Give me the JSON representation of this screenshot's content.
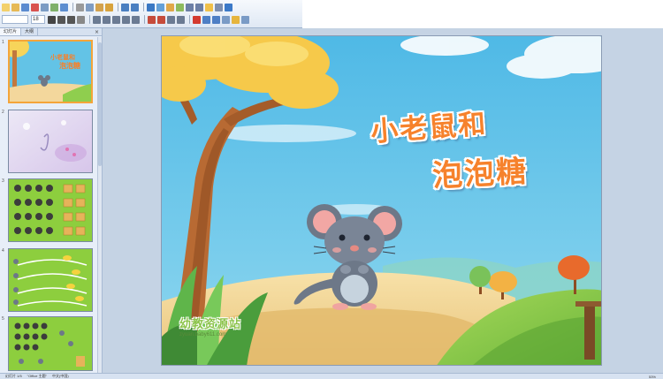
{
  "toolbar": {
    "font_size_value": "18"
  },
  "pane": {
    "tabs": [
      "幻灯片",
      "大纲"
    ],
    "close": "×",
    "slides": [
      {
        "number": "1",
        "selected": true,
        "title_line1": "小老鼠和",
        "title_line2": "泡泡糖"
      },
      {
        "number": "2",
        "selected": false
      },
      {
        "number": "3",
        "selected": false
      },
      {
        "number": "4",
        "selected": false
      },
      {
        "number": "5",
        "selected": false
      }
    ]
  },
  "slide": {
    "title_line1": "小老鼠和",
    "title_line2": "泡泡糖",
    "watermark_cn": "幼教资源站",
    "watermark_url": "zyuan.baby611.com"
  },
  "status": {
    "slide_info": "幻灯片 1/5",
    "theme": "\"Office 主题\"",
    "language": "中文(中国)",
    "zoom": "53%"
  },
  "colors": {
    "title_orange": "#f6822c",
    "sky": "#63c3e6",
    "grass": "#8fce4e",
    "selection": "#f4a53a"
  }
}
